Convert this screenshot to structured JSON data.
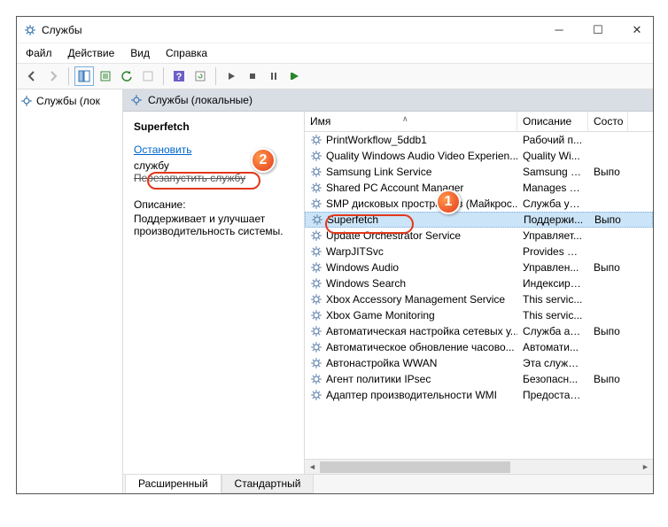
{
  "window": {
    "title": "Службы"
  },
  "menu": {
    "file": "Файл",
    "action": "Действие",
    "view": "Вид",
    "help": "Справка"
  },
  "tree": {
    "root": "Службы (лок"
  },
  "panel": {
    "header_label": "Службы (локальные)",
    "selected_name": "Superfetch",
    "action_stop_prefix": "Остановить",
    "action_stop_suffix": " службу",
    "action_restart": "Перезапустить службу",
    "descr_label": "Описание:",
    "descr_text": "Поддерживает и улучшает производительность системы."
  },
  "columns": {
    "name": "Имя",
    "desc": "Описание",
    "stat": "Состо"
  },
  "services": [
    {
      "name": "PrintWorkflow_5ddb1",
      "desc": "Рабочий п...",
      "stat": ""
    },
    {
      "name": "Quality Windows Audio Video Experien...",
      "desc": "Quality Wi...",
      "stat": ""
    },
    {
      "name": "Samsung Link Service",
      "desc": "Samsung L...",
      "stat": "Выпо"
    },
    {
      "name": "Shared PC Account Manager",
      "desc": "Manages p...",
      "stat": ""
    },
    {
      "name": "SMP дисковых пространств (Майкрос...",
      "desc": "Служба уз...",
      "stat": ""
    },
    {
      "name": "Superfetch",
      "desc": "Поддержи...",
      "stat": "Выпо",
      "selected": true
    },
    {
      "name": "Update Orchestrator Service",
      "desc": "Управляет...",
      "stat": ""
    },
    {
      "name": "WarpJITSvc",
      "desc": "Provides a ...",
      "stat": ""
    },
    {
      "name": "Windows Audio",
      "desc": "Управлен...",
      "stat": "Выпо"
    },
    {
      "name": "Windows Search",
      "desc": "Индексиро...",
      "stat": ""
    },
    {
      "name": "Xbox Accessory Management Service",
      "desc": "This servic...",
      "stat": ""
    },
    {
      "name": "Xbox Game Monitoring",
      "desc": "This servic...",
      "stat": ""
    },
    {
      "name": "Автоматическая настройка сетевых у...",
      "desc": "Служба ав...",
      "stat": "Выпо"
    },
    {
      "name": "Автоматическое обновление часово...",
      "desc": "Автомати...",
      "stat": ""
    },
    {
      "name": "Автонастройка WWAN",
      "desc": "Эта служб...",
      "stat": ""
    },
    {
      "name": "Агент политики IPsec",
      "desc": "Безопасн...",
      "stat": "Выпо"
    },
    {
      "name": "Адаптер производительности WMI",
      "desc": "Предостав...",
      "stat": ""
    }
  ],
  "tabs": {
    "extended": "Расширенный",
    "standard": "Стандартный"
  },
  "markers": {
    "m1": "1",
    "m2": "2"
  }
}
